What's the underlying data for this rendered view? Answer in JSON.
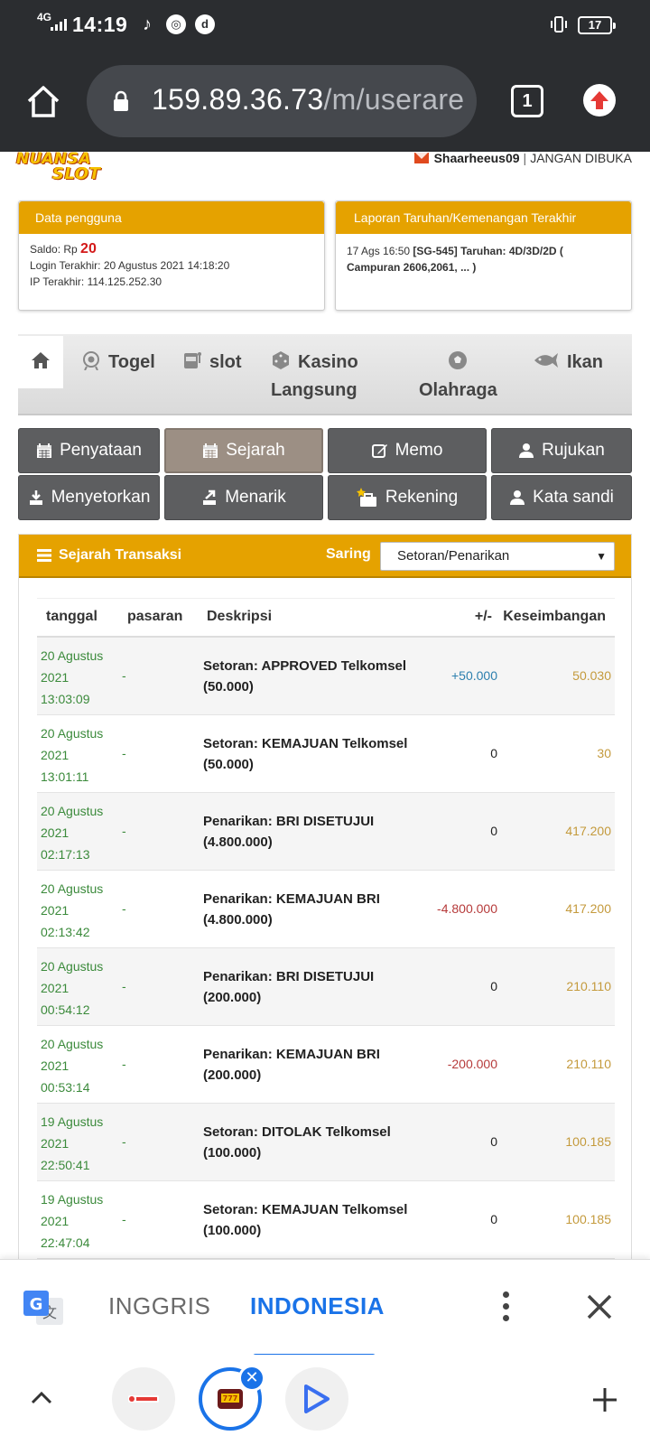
{
  "status_bar": {
    "network": "4G",
    "time": "14:19",
    "notification_icons": [
      "tiktok-icon",
      "chrome-icon",
      "d-app-icon"
    ],
    "battery": "17"
  },
  "browser": {
    "url_host": "159.89.36.73",
    "url_path": "/m/userare",
    "tab_count": "1"
  },
  "site": {
    "logo_line1": "NUANSA",
    "logo_line2": "SLOT",
    "username": "Shaarheeus09",
    "separator": "|",
    "user_note": "JANGAN DIBUKA"
  },
  "user_card": {
    "title": "Data pengguna",
    "saldo_label": "Saldo: Rp",
    "saldo_value": "20",
    "login_line": "Login Terakhir: 20 Agustus 2021 14:18:20",
    "ip_line": "IP Terakhir: 114.125.252.30"
  },
  "report_card": {
    "title": "Laporan Taruhan/Kemenangan Terakhir",
    "time": "17 Ags 16:50",
    "detail_line1": "[SG-545] Taruhan: 4D/3D/2D (",
    "detail_line2": "Campuran 2606,2061, ... )"
  },
  "category_nav": {
    "items": [
      {
        "label": "Togel",
        "icon": "lottery-icon"
      },
      {
        "label": "slot",
        "icon": "slot-machine-icon"
      },
      {
        "label": "Kasino",
        "label2": "Langsung",
        "icon": "dice-icon"
      },
      {
        "label": "Olahraga",
        "icon": "soccer-ball-icon"
      },
      {
        "label": "Ikan",
        "icon": "fish-icon"
      }
    ]
  },
  "menu_buttons": [
    {
      "label": "Penyataan",
      "icon": "calendar-icon",
      "active": false
    },
    {
      "label": "Sejarah",
      "icon": "calendar-icon",
      "active": true
    },
    {
      "label": "Memo",
      "icon": "edit-icon",
      "active": false
    },
    {
      "label": "Rujukan",
      "icon": "user-icon",
      "active": false
    },
    {
      "label": "Menyetorkan",
      "icon": "deposit-icon",
      "active": false
    },
    {
      "label": "Menarik",
      "icon": "withdraw-icon",
      "active": false
    },
    {
      "label": "Rekening",
      "icon": "briefcase-star-icon",
      "active": false
    },
    {
      "label": "Kata sandi",
      "icon": "user-icon",
      "active": false
    }
  ],
  "transactions": {
    "title": "Sejarah Transaksi",
    "filter_label": "Saring",
    "filter_value": "Setoran/Penarikan",
    "columns": [
      "tanggal",
      "pasaran",
      "Deskripsi",
      "+/-",
      "Keseimbangan"
    ],
    "rows": [
      {
        "date1": "20 Agustus",
        "date2": "2021",
        "date3": "13:03:09",
        "pasaran": "-",
        "desc": "Setoran: APPROVED Telkomsel (50.000)",
        "amount": "+50.000",
        "amount_type": "pos",
        "balance": "50.030"
      },
      {
        "date1": "20 Agustus",
        "date2": "2021",
        "date3": "13:01:11",
        "pasaran": "-",
        "desc": "Setoran: KEMAJUAN Telkomsel (50.000)",
        "amount": "0",
        "amount_type": "zero",
        "balance": "30"
      },
      {
        "date1": "20 Agustus",
        "date2": "2021",
        "date3": "02:17:13",
        "pasaran": "-",
        "desc": "Penarikan: BRI DISETUJUI (4.800.000)",
        "amount": "0",
        "amount_type": "zero",
        "balance": "417.200"
      },
      {
        "date1": "20 Agustus",
        "date2": "2021",
        "date3": "02:13:42",
        "pasaran": "-",
        "desc": "Penarikan: KEMAJUAN BRI (4.800.000)",
        "amount": "-4.800.000",
        "amount_type": "neg",
        "balance": "417.200"
      },
      {
        "date1": "20 Agustus",
        "date2": "2021",
        "date3": "00:54:12",
        "pasaran": "-",
        "desc": "Penarikan: BRI DISETUJUI (200.000)",
        "amount": "0",
        "amount_type": "zero",
        "balance": "210.110"
      },
      {
        "date1": "20 Agustus",
        "date2": "2021",
        "date3": "00:53:14",
        "pasaran": "-",
        "desc": "Penarikan: KEMAJUAN BRI (200.000)",
        "amount": "-200.000",
        "amount_type": "neg",
        "balance": "210.110"
      },
      {
        "date1": "19 Agustus",
        "date2": "2021",
        "date3": "22:50:41",
        "pasaran": "-",
        "desc": "Setoran: DITOLAK Telkomsel (100.000)",
        "amount": "0",
        "amount_type": "zero",
        "balance": "100.185"
      },
      {
        "date1": "19 Agustus",
        "date2": "2021",
        "date3": "22:47:04",
        "pasaran": "-",
        "desc": "Setoran: KEMAJUAN Telkomsel (100.000)",
        "amount": "0",
        "amount_type": "zero",
        "balance": "100.185"
      }
    ]
  },
  "translate_bar": {
    "source_lang": "INGGRIS",
    "target_lang": "INDONESIA"
  },
  "bottom_tabs": {
    "close_badge": "✕"
  },
  "colors": {
    "accent_orange": "#e5a200",
    "button_gray": "#5d5e60",
    "button_active": "#9c8f84",
    "positive": "#2c7fae",
    "negative": "#b63a3a",
    "balance": "#c49a3c",
    "date_green": "#3b8a3b",
    "translate_blue": "#1a73e8"
  }
}
